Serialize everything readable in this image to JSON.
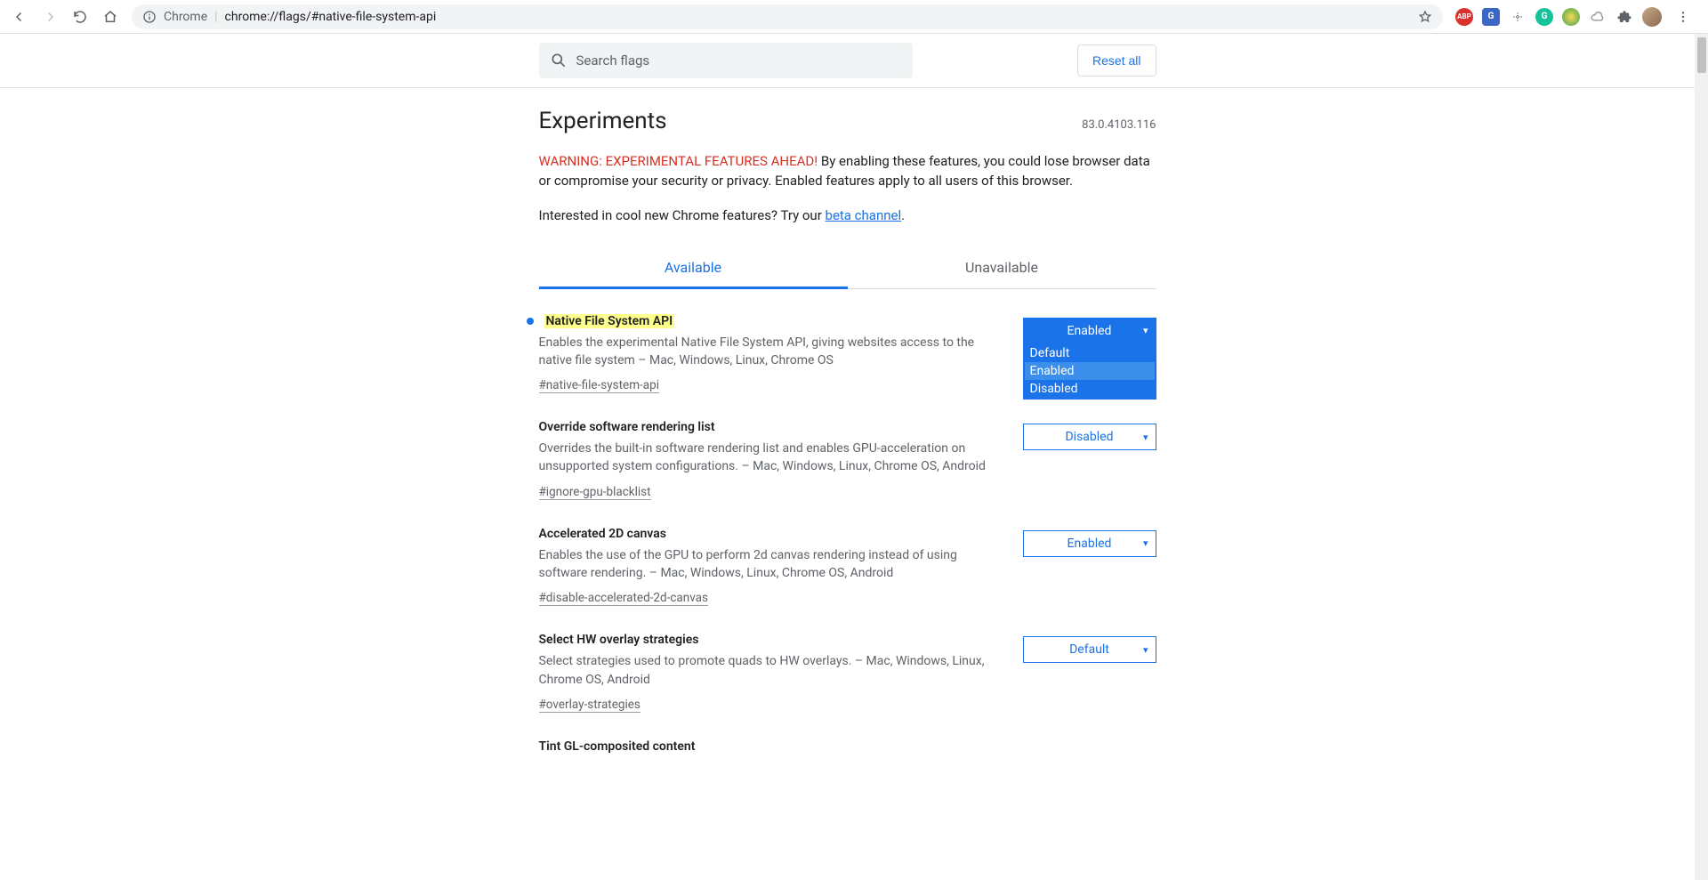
{
  "browser": {
    "url_host": "Chrome",
    "url_path": "chrome://flags/#native-file-system-api"
  },
  "extensions": {
    "abp": "ABP",
    "gt": "G",
    "grammarly": "G",
    "world": "🌐",
    "cloud": "☁",
    "puzzle": "✦"
  },
  "search": {
    "placeholder": "Search flags"
  },
  "reset_label": "Reset all",
  "title": "Experiments",
  "version": "83.0.4103.116",
  "warning_red": "WARNING: EXPERIMENTAL FEATURES AHEAD!",
  "warning_rest": " By enabling these features, you could lose browser data or compromise your security or privacy. Enabled features apply to all users of this browser.",
  "interested_prefix": "Interested in cool new Chrome features? Try our ",
  "beta_link": "beta channel",
  "tabs": {
    "available": "Available",
    "unavailable": "Unavailable"
  },
  "dropdown_options": {
    "default": "Default",
    "enabled": "Enabled",
    "disabled": "Disabled"
  },
  "flags": [
    {
      "title": "Native File System API",
      "highlighted": true,
      "bullet": true,
      "desc": "Enables the experimental Native File System API, giving websites access to the native file system – Mac, Windows, Linux, Chrome OS",
      "anchor": "#native-file-system-api",
      "value": "Enabled",
      "filled": true,
      "open": true
    },
    {
      "title": "Override software rendering list",
      "desc": "Overrides the built-in software rendering list and enables GPU-acceleration on unsupported system configurations. – Mac, Windows, Linux, Chrome OS, Android",
      "anchor": "#ignore-gpu-blacklist",
      "value": "Disabled"
    },
    {
      "title": "Accelerated 2D canvas",
      "desc": "Enables the use of the GPU to perform 2d canvas rendering instead of using software rendering. – Mac, Windows, Linux, Chrome OS, Android",
      "anchor": "#disable-accelerated-2d-canvas",
      "value": "Enabled"
    },
    {
      "title": "Select HW overlay strategies",
      "desc": "Select strategies used to promote quads to HW overlays. – Mac, Windows, Linux, Chrome OS, Android",
      "anchor": "#overlay-strategies",
      "value": "Default"
    },
    {
      "title": "Tint GL-composited content",
      "desc": "",
      "anchor": "",
      "value": ""
    }
  ]
}
